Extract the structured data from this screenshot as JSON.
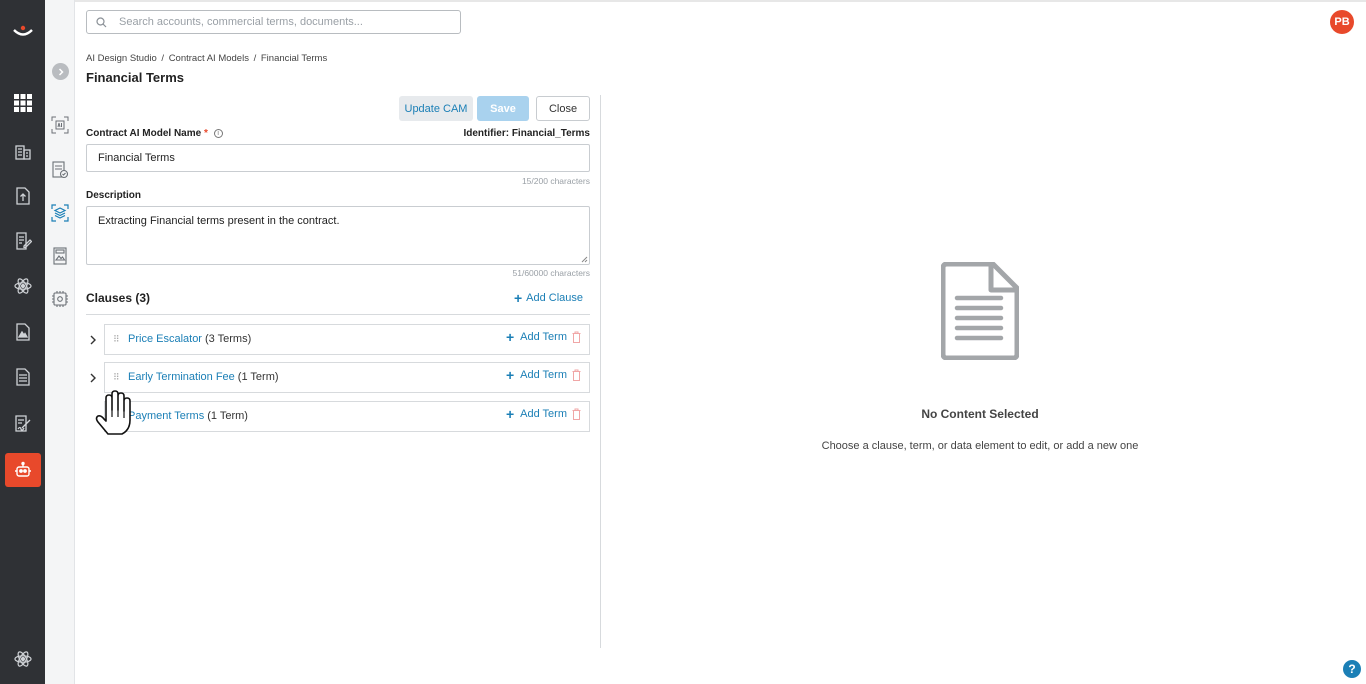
{
  "search": {
    "placeholder": "Search accounts, commercial terms, documents..."
  },
  "user": {
    "initials": "PB"
  },
  "breadcrumb": {
    "items": [
      "AI Design Studio",
      "Contract AI Models",
      "Financial Terms"
    ],
    "separator": "/"
  },
  "page": {
    "title": "Financial Terms"
  },
  "actions": {
    "update_label": "Update CAM",
    "save_label": "Save",
    "close_label": "Close"
  },
  "form": {
    "name_label": "Contract AI Model Name",
    "required_mark": "*",
    "identifier": "Identifier: Financial_Terms",
    "name_value": "Financial Terms",
    "name_count": "15/200 characters",
    "desc_label": "Description",
    "desc_value": "Extracting Financial terms present in the contract.",
    "desc_count": "51/60000 characters"
  },
  "clauses": {
    "heading": "Clauses (3)",
    "add_label": "Add Clause",
    "add_term_label": "Add Term",
    "items": [
      {
        "name": "Price Escalator",
        "terms": "(3 Terms)"
      },
      {
        "name": "Early Termination Fee",
        "terms": "(1 Term)"
      },
      {
        "name": "Payment Terms",
        "terms": "(1 Term)"
      }
    ]
  },
  "empty_state": {
    "title": "No Content Selected",
    "subtitle": "Choose a clause, term, or data element to edit, or add a new one"
  },
  "help": {
    "label": "?"
  },
  "colors": {
    "accent": "#e8492b",
    "link": "#1b7fb6",
    "rail": "#2f3135"
  }
}
